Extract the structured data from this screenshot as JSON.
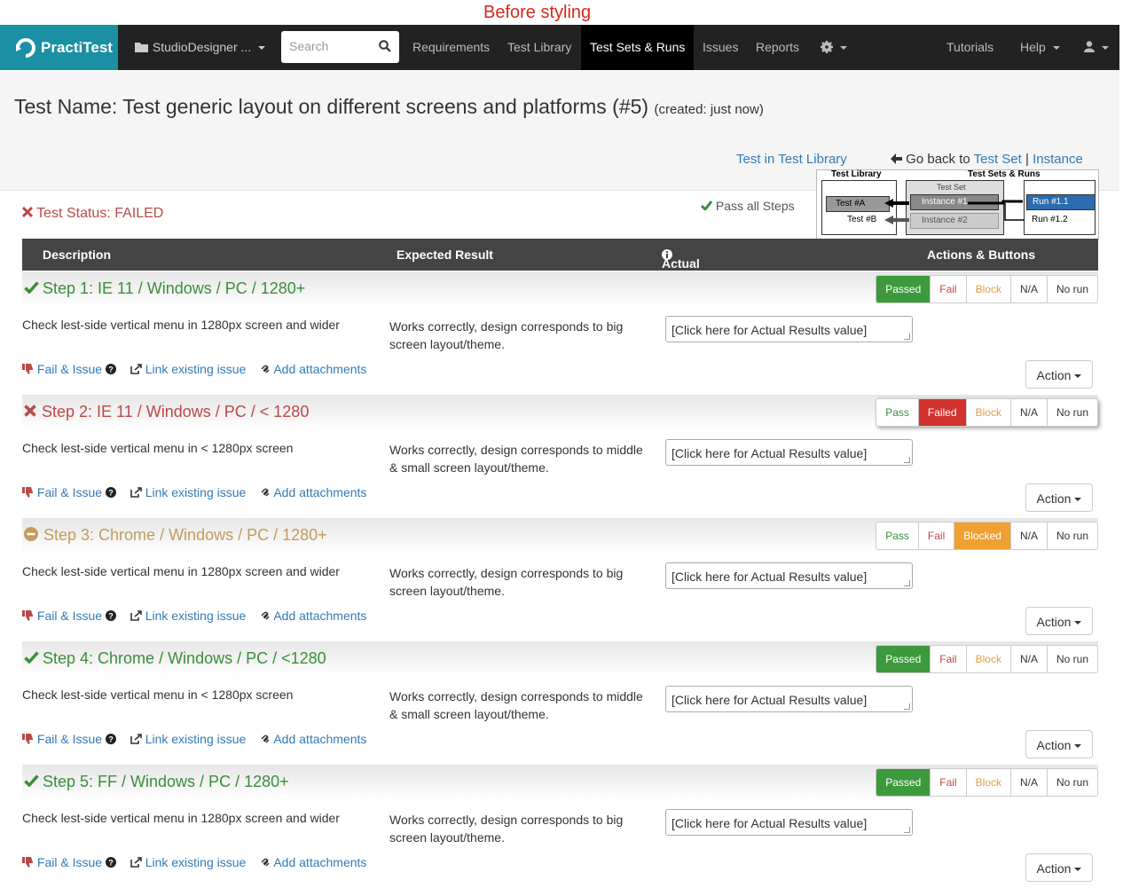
{
  "banner": "Before styling",
  "nav": {
    "logo": "PractiTest",
    "project": "StudioDesigner ...",
    "search_placeholder": "Search",
    "items": [
      "Requirements",
      "Test Library",
      "Test Sets & Runs",
      "Issues",
      "Reports"
    ],
    "tutorials": "Tutorials",
    "help": "Help"
  },
  "header": {
    "title": "Test Name: Test generic layout on different screens and platforms (#5)",
    "created": "(created: just now)",
    "test_in_library": "Test in Test Library",
    "go_back": "Go back to",
    "test_set": "Test Set",
    "separator": "|",
    "instance": "Instance"
  },
  "diagram": {
    "library_label": "Test Library",
    "sets_label": "Test Sets & Runs",
    "test_set_label": "Test Set",
    "test_a": "Test #A",
    "test_b": "Test #B",
    "instance_1": "Instance #1",
    "instance_2": "Instance #2",
    "run_1": "Run #1.1",
    "run_2": "Run #1.2",
    "ellipsis": "..."
  },
  "status": {
    "label": "Test Status: FAILED",
    "pass_all": "Pass all Steps"
  },
  "table": {
    "columns": [
      "Description",
      "Expected Result",
      "Actual Result",
      "Actions & Buttons"
    ]
  },
  "colors": {
    "passed": "#3c9a3c",
    "failed": "#d2322d",
    "blocked": "#f0a030",
    "link": "#337ab7",
    "logo_bg": "#1b8fa3"
  },
  "links": {
    "fail_issue": "Fail & Issue",
    "link_issue": "Link existing issue",
    "attach": "Add attachments",
    "action": "Action"
  },
  "steps": [
    {
      "title": "Step 1: IE 11 / Windows / PC / 1280+",
      "state": "passed",
      "buttons": [
        "Passed",
        "Fail",
        "Block",
        "N/A",
        "No run"
      ],
      "description": "Check lest-side vertical menu in 1280px screen and wider",
      "expected": "Works correctly, design corresponds to big screen layout/theme.",
      "actual": "[Click here for Actual Results value]"
    },
    {
      "title": "Step 2: IE 11 / Windows / PC / < 1280",
      "state": "failed",
      "buttons": [
        "Pass",
        "Failed",
        "Block",
        "N/A",
        "No run"
      ],
      "description": "Check lest-side vertical menu in < 1280px screen",
      "expected": "Works correctly, design corresponds to middle & small screen layout/theme.",
      "actual": "[Click here for Actual Results value]"
    },
    {
      "title": "Step 3: Chrome / Windows / PC / 1280+",
      "state": "blocked",
      "buttons": [
        "Pass",
        "Fail",
        "Blocked",
        "N/A",
        "No run"
      ],
      "description": "Check lest-side vertical menu in 1280px screen and wider",
      "expected": "Works correctly, design corresponds to big screen layout/theme.",
      "actual": "[Click here for Actual Results value]"
    },
    {
      "title": "Step 4: Chrome / Windows / PC / <1280",
      "state": "passed",
      "buttons": [
        "Passed",
        "Fail",
        "Block",
        "N/A",
        "No run"
      ],
      "description": "Check lest-side vertical menu in < 1280px screen",
      "expected": "Works correctly, design corresponds to middle & small screen layout/theme.",
      "actual": "[Click here for Actual Results value]"
    },
    {
      "title": "Step 5: FF / Windows / PC / 1280+",
      "state": "passed",
      "buttons": [
        "Passed",
        "Fail",
        "Block",
        "N/A",
        "No run"
      ],
      "description": "Check lest-side vertical menu in 1280px screen and wider",
      "expected": "Works correctly, design corresponds to big screen layout/theme.",
      "actual": "[Click here for Actual Results value]"
    }
  ]
}
